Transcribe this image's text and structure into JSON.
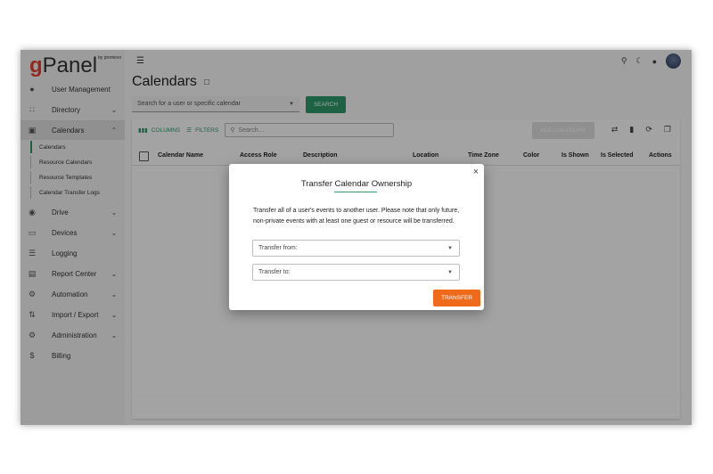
{
  "logo": {
    "letter_g": "g",
    "rest": "Panel",
    "tm": "by promevo"
  },
  "sidebar": {
    "items": [
      {
        "label": "User Management",
        "icon": "person-icon",
        "glyph": "👤",
        "chevron": ""
      },
      {
        "label": "Directory",
        "icon": "group-icon",
        "glyph": "👥",
        "chevron": "⌄"
      },
      {
        "label": "Calendars",
        "icon": "calendar-icon",
        "glyph": "📅",
        "chevron": "⌃"
      },
      {
        "label": "Drive",
        "icon": "drive-icon",
        "glyph": "⛁",
        "chevron": "⌄"
      },
      {
        "label": "Devices",
        "icon": "devices-icon",
        "glyph": "▭",
        "chevron": "⌄"
      },
      {
        "label": "Logging",
        "icon": "list-icon",
        "glyph": "☰",
        "chevron": ""
      },
      {
        "label": "Report Center",
        "icon": "report-icon",
        "glyph": "▤",
        "chevron": "⌄"
      },
      {
        "label": "Automation",
        "icon": "gear-icon",
        "glyph": "⚙",
        "chevron": "⌄"
      },
      {
        "label": "Import / Export",
        "icon": "import-export-icon",
        "glyph": "⇅",
        "chevron": "⌄"
      },
      {
        "label": "Administration",
        "icon": "admin-gears-icon",
        "glyph": "⚙",
        "chevron": "⌄"
      },
      {
        "label": "Billing",
        "icon": "dollar-icon",
        "glyph": "$",
        "chevron": ""
      }
    ],
    "calendar_subitems": [
      "Calendars",
      "Resource Calendars",
      "Resource Templates",
      "Calendar Transfer Logs"
    ]
  },
  "header": {
    "title": "Calendars",
    "search_placeholder": "Search for a user or specific calendar",
    "search_button": "SEARCH"
  },
  "toolbar": {
    "columns_label": "COLUMNS",
    "filters_label": "FILTERS",
    "search_placeholder": "Search…",
    "add_calendar": "ADD CALENDAR"
  },
  "table": {
    "columns": [
      "Calendar Name",
      "Access Role",
      "Description",
      "Location",
      "Time Zone",
      "Color",
      "Is Shown",
      "Is Selected",
      "Actions"
    ]
  },
  "dialog": {
    "title": "Transfer Calendar Ownership",
    "description": "Transfer all of a user's events to another user. Please note that only future, non-private events with at least one guest or resource will be transferred.",
    "transfer_from_label": "Transfer from:",
    "transfer_to_label": "Transfer to:",
    "transfer_button": "TRANSFER",
    "close": "×"
  },
  "colors": {
    "accent": "#2e9a6d",
    "transfer": "#f06a1b",
    "logo_red": "#e8432e"
  }
}
